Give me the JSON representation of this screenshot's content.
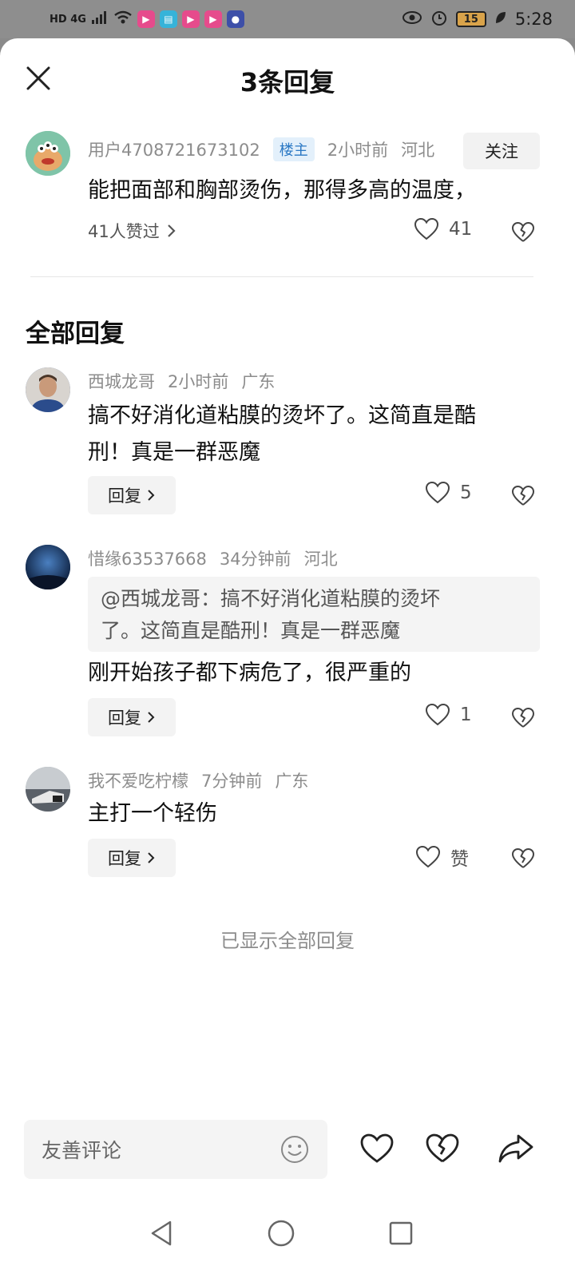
{
  "status_bar": {
    "left_text": "HD 4G",
    "time": "5:28",
    "battery": "15"
  },
  "header": {
    "title": "3条回复"
  },
  "main_comment": {
    "username": "用户4708721673102",
    "badge": "楼主",
    "time": "2小时前",
    "location": "河北",
    "follow_label": "关注",
    "text": "能把面部和胸部烫伤，那得多高的温度，",
    "likers": "41人赞过",
    "like_count": "41"
  },
  "section_title": "全部回复",
  "replies": [
    {
      "username": "西城龙哥",
      "time": "2小时前",
      "location": "广东",
      "text_line1": "搞不好消化道粘膜的烫坏了。这简直是酷",
      "text_line2": "刑！真是一群恶魔",
      "reply_label": "回复",
      "like_count": "5"
    },
    {
      "username": "惜缘63537668",
      "time": "34分钟前",
      "location": "河北",
      "quote_line1": "@西城龙哥：搞不好消化道粘膜的烫坏",
      "quote_line2": "了。这简直是酷刑！真是一群恶魔",
      "text_line1": "刚开始孩子都下病危了，很严重的",
      "reply_label": "回复",
      "like_count": "1"
    },
    {
      "username": "我不爱吃柠檬",
      "time": "7分钟前",
      "location": "广东",
      "text_line1": "主打一个轻伤",
      "reply_label": "回复",
      "like_count": "赞"
    }
  ],
  "end_text": "已显示全部回复",
  "bottom_bar": {
    "placeholder": "友善评论"
  },
  "colors": {
    "badge_bg": "#e3f0fb",
    "badge_text": "#2a78c4",
    "muted": "#8c8c8c"
  }
}
